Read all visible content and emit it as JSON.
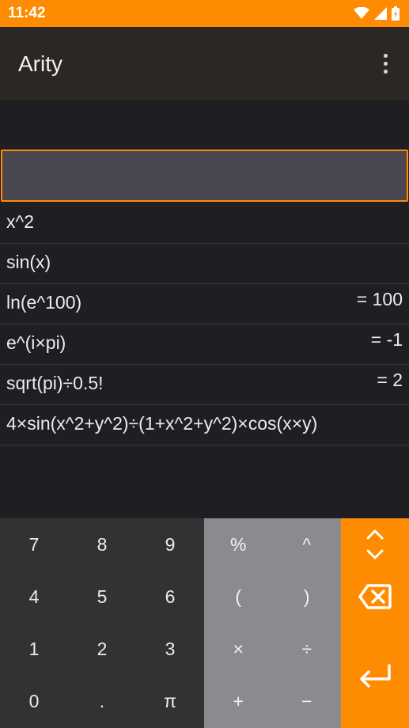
{
  "status_bar": {
    "time": "11:42",
    "icons": [
      "wifi-icon",
      "cell-signal-icon",
      "battery-icon"
    ],
    "bg_color": "#ff8c00"
  },
  "app_bar": {
    "title": "Arity",
    "menu_icon": "more-vert-icon"
  },
  "input": {
    "value": "",
    "accent_color": "#ff8c00"
  },
  "history": [
    {
      "expr": "x^2",
      "result": ""
    },
    {
      "expr": "sin(x)",
      "result": ""
    },
    {
      "expr": "ln(e^100)",
      "result": "= 100"
    },
    {
      "expr": "e^(i×pi)",
      "result": "= -1"
    },
    {
      "expr": "sqrt(pi)÷0.5!",
      "result": "= 2"
    },
    {
      "expr": "4×sin(x^2+y^2)÷(1+x^2+y^2)×cos(x×y)",
      "result": ""
    }
  ],
  "keypad": {
    "digits": [
      "7",
      "8",
      "9",
      "4",
      "5",
      "6",
      "1",
      "2",
      "3",
      "0",
      ".",
      "π"
    ],
    "operators": [
      "%",
      "^",
      "(",
      ")",
      "×",
      "÷",
      "+",
      "−"
    ],
    "side": [
      "toggle-expand-icon",
      "backspace-icon",
      "enter-icon"
    ]
  }
}
